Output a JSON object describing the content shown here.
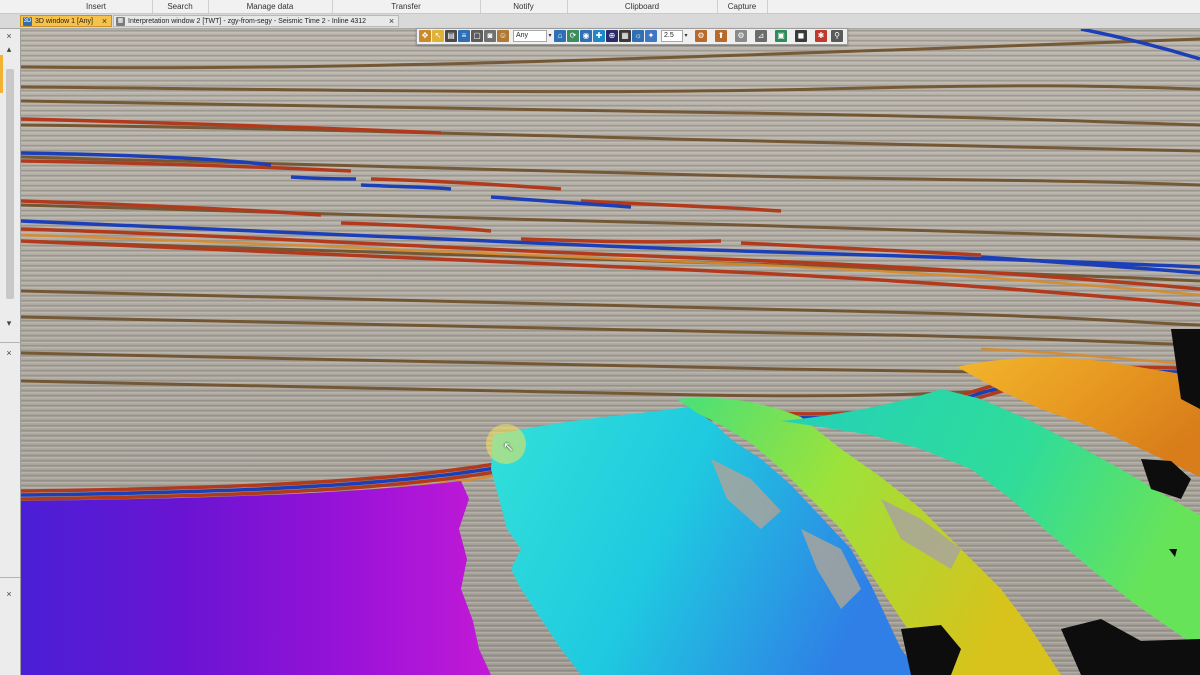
{
  "ribbon": {
    "groups": [
      "Insert",
      "Search",
      "Manage data",
      "Transfer",
      "Notify",
      "Clipboard",
      "Capture"
    ]
  },
  "tabs": [
    {
      "label": "3D window 1 [Any]",
      "icon": "3d-window-icon",
      "active": true
    },
    {
      "label": "Interpretation window 2 [TWT] - zgy-from-segy - Seismic Time 2 - Inline 4312",
      "icon": "interpretation-window-icon",
      "active": false
    }
  ],
  "toolbar": {
    "domain_value": "Any",
    "vertical_exaggeration": "2.5",
    "icons": [
      "select-icon",
      "pick-icon",
      "print-icon",
      "layers-icon",
      "bookmark-icon",
      "camera-icon",
      "person-icon",
      "home-icon",
      "rotate-icon",
      "view-icon",
      "pan-icon",
      "zoom-icon",
      "grid-icon",
      "sun-icon",
      "light-icon",
      "scale-icon",
      "north-arrow-icon",
      "settings-icon",
      "display-icon",
      "filter-icon",
      "pin-icon"
    ]
  },
  "colors": {
    "active_tab": "#f7c24a",
    "seismic_positive": "#b23a1c",
    "seismic_negative": "#1c3fb8",
    "seismic_background": "#a8a49c"
  }
}
